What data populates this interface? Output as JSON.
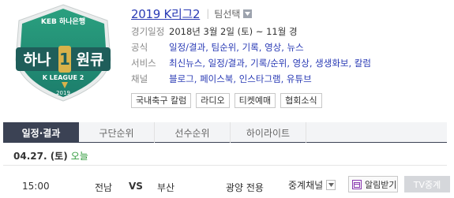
{
  "logo": {
    "sponsor": "KEB 하나은행",
    "name_left": "하나",
    "name_digit": "1",
    "name_right": "원큐",
    "league": "K LEAGUE 2",
    "year": "2019",
    "colors": {
      "green": "#1c8c73",
      "dark": "#1f5e5a",
      "gold": "#d8b24a"
    }
  },
  "header": {
    "title": "2019 K리그2",
    "team_select_label": "팀선택"
  },
  "info_rows": [
    {
      "label": "경기일정",
      "value": "2018년 3월 2일 (토) ~ 11월 경"
    },
    {
      "label": "공식",
      "links": [
        "일정/결과",
        "팀순위",
        "기록",
        "영상",
        "뉴스"
      ]
    },
    {
      "label": "서비스",
      "links": [
        "최신뉴스",
        "일정/결과",
        "기록/순위",
        "영상",
        "생생화보",
        "칼럼"
      ]
    },
    {
      "label": "채널",
      "links": [
        "블로그",
        "페이스북",
        "인스타그램",
        "유튜브"
      ]
    }
  ],
  "tags": [
    "국내축구 칼럼",
    "라디오",
    "티켓예매",
    "협회소식"
  ],
  "tabs": [
    {
      "label": "일정·결과",
      "active": true
    },
    {
      "label": "구단순위",
      "active": false
    },
    {
      "label": "선수순위",
      "active": false
    },
    {
      "label": "하이라이트",
      "active": false
    }
  ],
  "date_row": {
    "date": "04.27. (토)",
    "today": "오늘"
  },
  "match": {
    "time": "15:00",
    "home": "전남",
    "vs": "VS",
    "away": "부산",
    "venue": "광양 전용",
    "channel": "중계채널",
    "alarm": "알림받기",
    "tv": "TV중계"
  }
}
